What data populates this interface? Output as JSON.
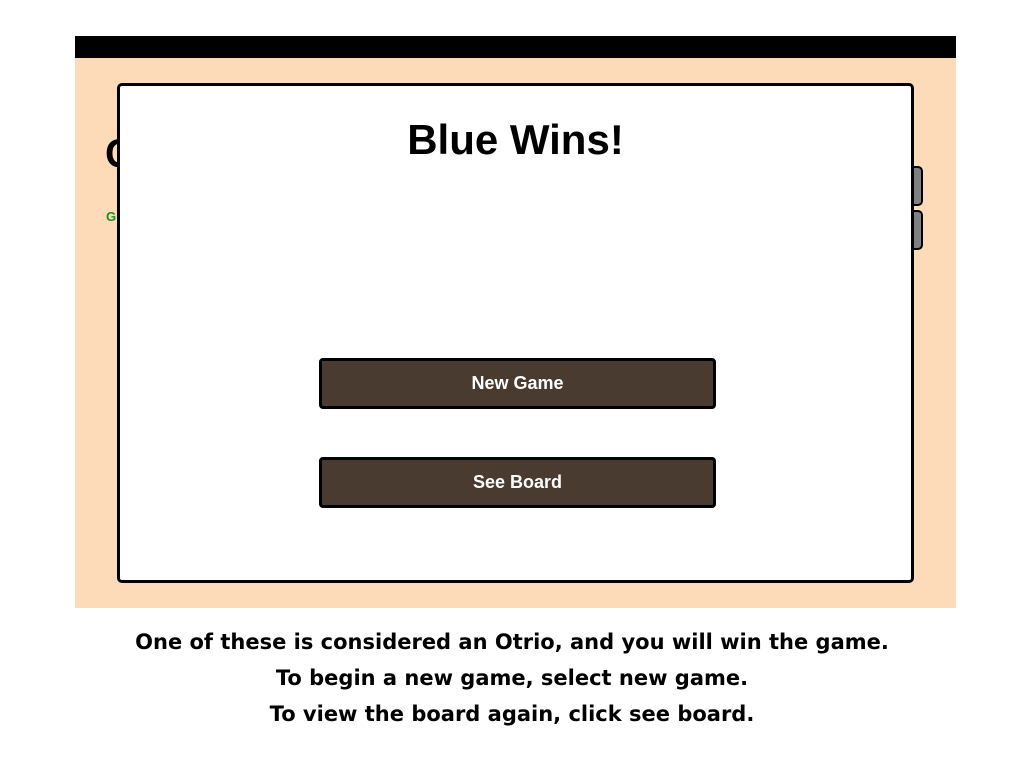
{
  "colors": {
    "game_background": "#fddbb9",
    "top_bar": "#000000",
    "modal_background": "#ffffff",
    "button_background": "#4a3b30",
    "button_text": "#ffffff",
    "status_text": "#1a8f1a"
  },
  "background": {
    "title_partial": "C",
    "status_partial": "G"
  },
  "modal": {
    "title": "Blue Wins!",
    "new_game_label": "New Game",
    "see_board_label": "See Board"
  },
  "instructions": {
    "line1": "One of these is considered an Otrio, and you will win the game.",
    "line2": "To begin a new game, select new game.",
    "line3": "To view the board again, click see board."
  }
}
